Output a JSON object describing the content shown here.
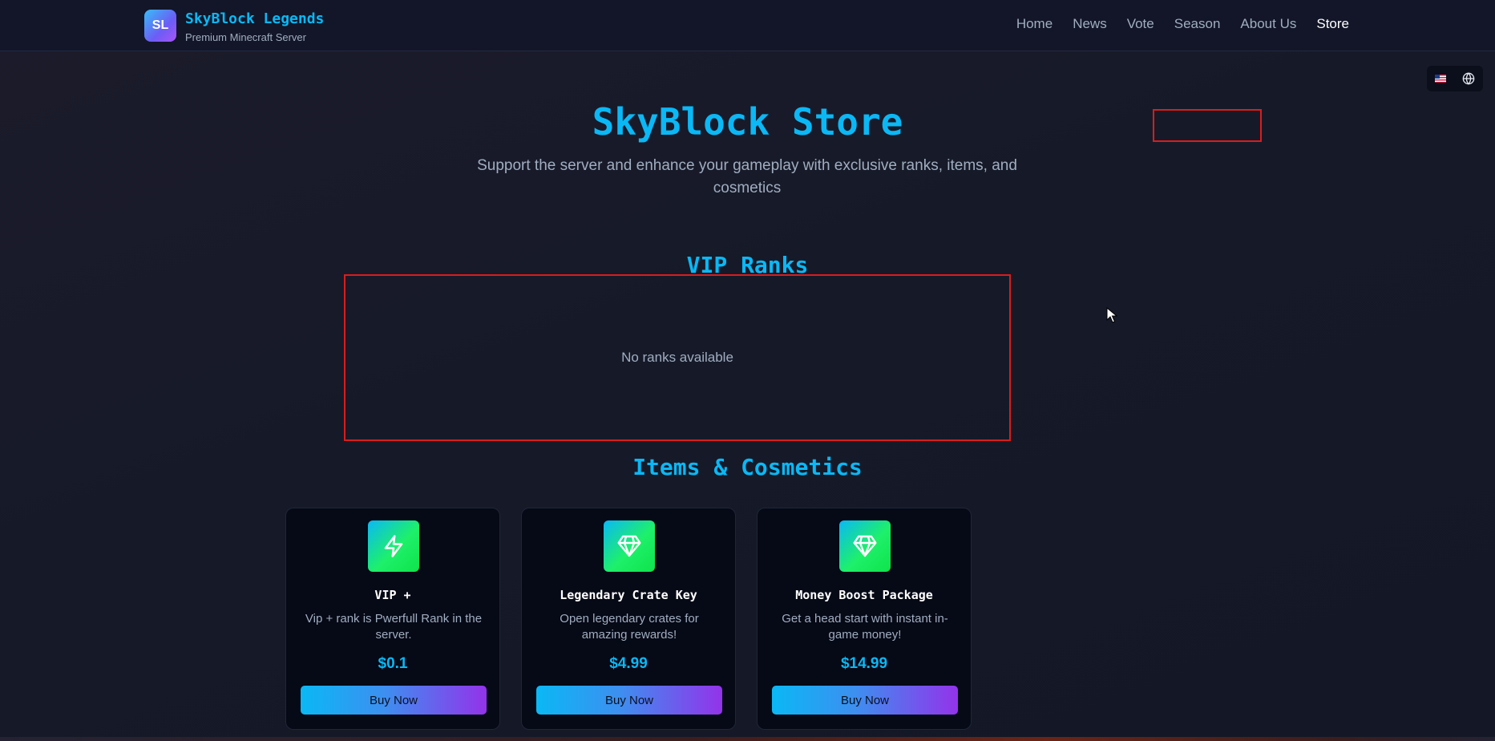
{
  "header": {
    "logo_text": "SL",
    "brand_name": "SkyBlock Legends",
    "tagline": "Premium Minecraft Server",
    "nav": [
      {
        "label": "Home",
        "active": false
      },
      {
        "label": "News",
        "active": false
      },
      {
        "label": "Vote",
        "active": false
      },
      {
        "label": "Season",
        "active": false
      },
      {
        "label": "About Us",
        "active": false
      },
      {
        "label": "Store",
        "active": true
      }
    ]
  },
  "language_switcher": {
    "flag": "us-flag-icon",
    "globe": "globe-icon"
  },
  "hero": {
    "title": "SkyBlock Store",
    "subtitle": "Support the server and enhance your gameplay with exclusive ranks, items, and cosmetics"
  },
  "ranks_section": {
    "title": "VIP Ranks",
    "empty_message": "No ranks available"
  },
  "items_section": {
    "title": "Items & Cosmetics",
    "items": [
      {
        "icon": "lightning-icon",
        "name": "VIP +",
        "description": "Vip + rank is Pwerfull Rank in the server.",
        "price": "$0.1",
        "button_label": "Buy Now"
      },
      {
        "icon": "diamond-icon",
        "name": "Legendary Crate Key",
        "description": "Open legendary crates for amazing rewards!",
        "price": "$4.99",
        "button_label": "Buy Now"
      },
      {
        "icon": "diamond-icon",
        "name": "Money Boost Package",
        "description": "Get a head start with instant in-game money!",
        "price": "$14.99",
        "button_label": "Buy Now"
      }
    ]
  },
  "colors": {
    "accent": "#0ab8f5",
    "background": "#161a28",
    "card_background": "#060916",
    "icon_gradient_end": "#1ef06a",
    "button_gradient_end": "#9333ea",
    "highlight_border": "#d91d1d"
  }
}
